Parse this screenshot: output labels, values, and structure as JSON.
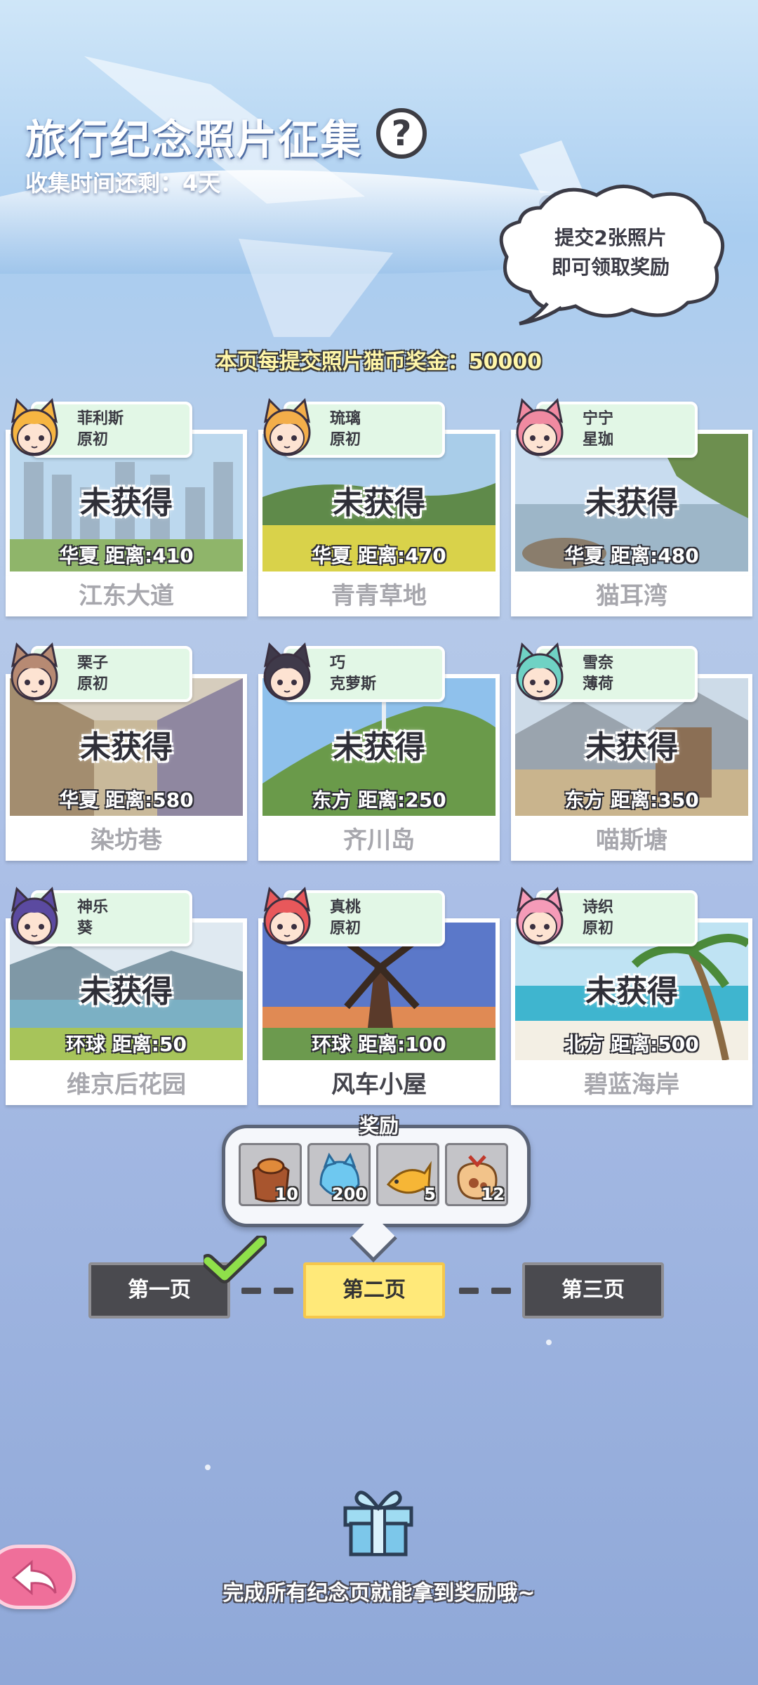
{
  "header": {
    "title": "旅行纪念照片征集",
    "help_icon": "?",
    "countdown": "收集时间还剩：4天",
    "cloud_line1": "提交2张照片",
    "cloud_line2": "即可领取奖励",
    "bonus": "本页每提交照片猫币奖金：50000"
  },
  "cards": [
    {
      "char_name": "菲利斯",
      "char_outfit": "原初",
      "status": "未获得",
      "region": "华夏",
      "distance": "距离:410",
      "location": "江东大道",
      "hair": "#f6b542",
      "scene": "city"
    },
    {
      "char_name": "琉璃",
      "char_outfit": "原初",
      "status": "未获得",
      "region": "华夏",
      "distance": "距离:470",
      "location": "青青草地",
      "hair": "#f3ae4a",
      "scene": "meadow"
    },
    {
      "char_name": "宁宁",
      "char_outfit": "星珈",
      "status": "未获得",
      "region": "华夏",
      "distance": "距离:480",
      "location": "猫耳湾",
      "hair": "#f08aa1",
      "scene": "coast"
    },
    {
      "char_name": "栗子",
      "char_outfit": "原初",
      "status": "未获得",
      "region": "华夏",
      "distance": "距离:580",
      "location": "染坊巷",
      "hair": "#b78a73",
      "scene": "alley"
    },
    {
      "char_name": "巧",
      "char_outfit": "克萝斯",
      "status": "未获得",
      "region": "东方",
      "distance": "距离:250",
      "location": "齐川岛",
      "hair": "#3f3a4a",
      "scene": "hill"
    },
    {
      "char_name": "雪奈",
      "char_outfit": "薄荷",
      "status": "未获得",
      "region": "东方",
      "distance": "距离:350",
      "location": "喵斯塘",
      "hair": "#6fd2c4",
      "scene": "temple"
    },
    {
      "char_name": "神乐",
      "char_outfit": "葵",
      "status": "未获得",
      "region": "环球",
      "distance": "距离:50",
      "location": "维京后花园",
      "hair": "#5b4aa0",
      "scene": "fjord"
    },
    {
      "char_name": "真桃",
      "char_outfit": "原初",
      "status": "",
      "region": "环球",
      "distance": "距离:100",
      "location": "风车小屋",
      "hair": "#e8585b",
      "scene": "windmill"
    },
    {
      "char_name": "诗织",
      "char_outfit": "原初",
      "status": "未获得",
      "region": "北方",
      "distance": "距离:500",
      "location": "碧蓝海岸",
      "hair": "#f59bb8",
      "scene": "beach"
    }
  ],
  "reward": {
    "title": "奖励",
    "items": [
      {
        "icon": "fish-bag-icon",
        "count": "10"
      },
      {
        "icon": "blue-cat-ball-icon",
        "count": "200"
      },
      {
        "icon": "golden-fish-icon",
        "count": "5"
      },
      {
        "icon": "paw-bag-icon",
        "count": "12"
      }
    ]
  },
  "pages": {
    "page1": "第一页",
    "page2": "第二页",
    "page3": "第三页"
  },
  "bottom": {
    "tip": "完成所有纪念页就能拿到奖励哦~"
  }
}
